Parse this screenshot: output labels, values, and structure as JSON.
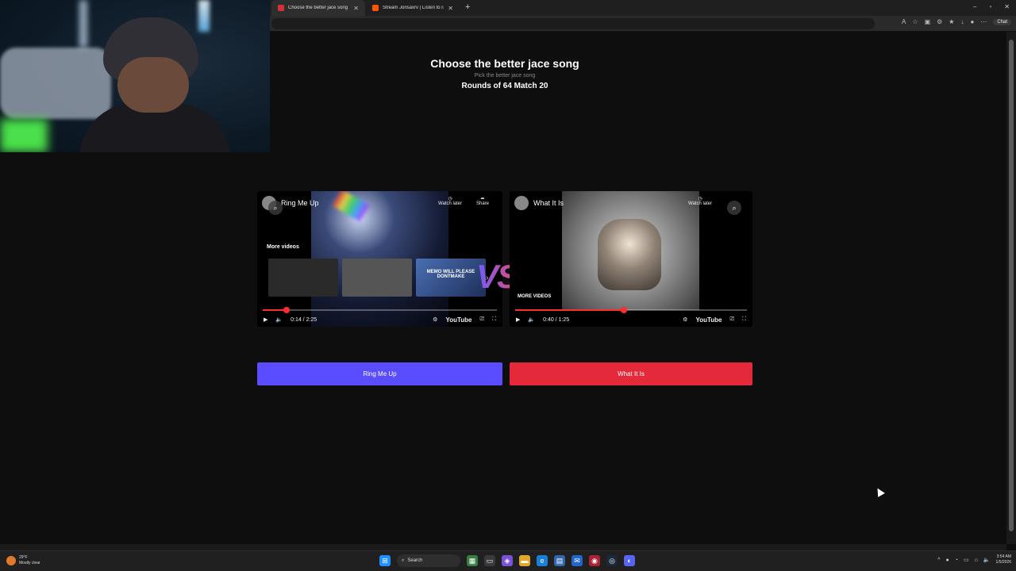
{
  "browser": {
    "tabs": [
      {
        "title": "Choose the better jace song |",
        "active": true,
        "favicon_color": "#d42f3a"
      },
      {
        "title": "Stream Jonsaxrv | Listen to rap pl",
        "active": false,
        "favicon_color": "#ff5500"
      }
    ],
    "new_tab": "+",
    "window_controls": [
      "–",
      "▫",
      "✕"
    ],
    "copilot_label": "Chat"
  },
  "page": {
    "title": "Choose the better jace song",
    "subtitle": "Pick the better jace song",
    "round": "Rounds of 64 Match 20",
    "vs": "VS"
  },
  "left_player": {
    "video_title": "Ring Me Up",
    "watch_later": "Watch later",
    "share": "Share",
    "more_videos": "More videos",
    "thumb3_text": "MEMO WILL PLEASE DONTMAKE",
    "time": "0:14 / 2:25",
    "progress": 0.1,
    "youtube": "YouTube",
    "button_label": "Ring Me Up",
    "button_color": "#5a4cff"
  },
  "right_player": {
    "video_title": "What It Is",
    "watch_later": "Watch later",
    "more_videos": "MORE VIDEOS",
    "time": "0:40 / 1:25",
    "progress": 0.47,
    "youtube": "YouTube",
    "button_label": "What It Is",
    "button_color": "#e42a3a"
  },
  "taskbar": {
    "weather_temp": "29°F",
    "weather_desc": "Mostly clear",
    "search": "Search",
    "time": "3:54 AM",
    "date": "1/5/2026"
  }
}
